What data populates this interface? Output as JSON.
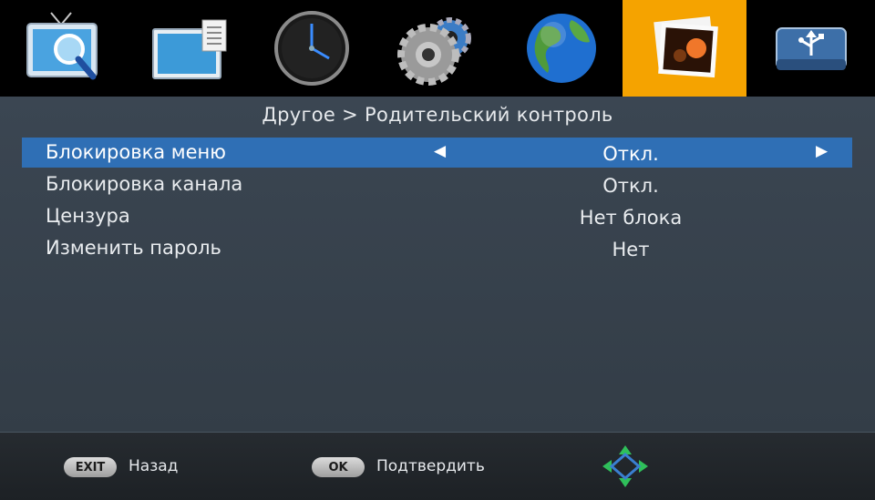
{
  "tabs": [
    {
      "name": "tv-icon",
      "active": false
    },
    {
      "name": "monitor-icon",
      "active": false
    },
    {
      "name": "clock-icon",
      "active": false
    },
    {
      "name": "gears-icon",
      "active": false
    },
    {
      "name": "globe-icon",
      "active": false
    },
    {
      "name": "photos-icon",
      "active": true
    },
    {
      "name": "usb-drive-icon",
      "active": false
    }
  ],
  "breadcrumb": "Другое > Родительский контроль",
  "menu": {
    "items": [
      {
        "label": "Блокировка меню",
        "value": "Откл.",
        "selected": true
      },
      {
        "label": "Блокировка канала",
        "value": "Откл.",
        "selected": false
      },
      {
        "label": "Цензура",
        "value": "Нет блока",
        "selected": false
      },
      {
        "label": "Изменить пароль",
        "value": "Нет",
        "selected": false
      }
    ],
    "arrow_left": "◀",
    "arrow_right": "▶"
  },
  "footer": {
    "exit_key": "EXIT",
    "exit_label": "Назад",
    "ok_key": "OK",
    "ok_label": "Подтвердить",
    "nav_icon": "navigation-pad-icon"
  },
  "colors": {
    "active_tab": "#f5a300",
    "selected_row": "#2f6fb5",
    "panel": "#38424d"
  }
}
